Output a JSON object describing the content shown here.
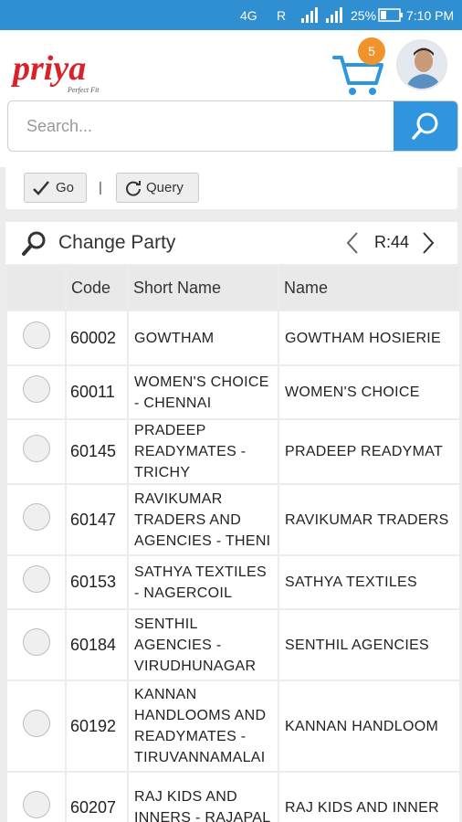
{
  "status_bar": {
    "network": "4G",
    "roaming": "R",
    "battery": "25%",
    "time": "7:10 PM"
  },
  "header": {
    "brand": "priya",
    "tagline": "Perfect Fit",
    "cart_count": "5"
  },
  "search": {
    "placeholder": "Search..."
  },
  "toolbar": {
    "go_label": "Go",
    "separator": "|",
    "query_label": "Query"
  },
  "party_panel": {
    "title": "Change Party",
    "record_count": "R:44"
  },
  "table": {
    "columns": [
      "",
      "Code",
      "Short Name",
      "Name"
    ],
    "rows": [
      {
        "code": "60002",
        "short_name": "GOWTHAM",
        "name": "GOWTHAM HOSIERIE"
      },
      {
        "code": "60011",
        "short_name": "WOMEN'S CHOICE - CHENNAI",
        "name": "WOMEN'S CHOICE"
      },
      {
        "code": "60145",
        "short_name": "PRADEEP READYMATES - TRICHY",
        "name": "PRADEEP READYMAT"
      },
      {
        "code": "60147",
        "short_name": "RAVIKUMAR TRADERS AND AGENCIES - THENI",
        "name": "RAVIKUMAR TRADERS"
      },
      {
        "code": "60153",
        "short_name": "SATHYA TEXTILES - NAGERCOIL",
        "name": "SATHYA TEXTILES"
      },
      {
        "code": "60184",
        "short_name": "SENTHIL AGENCIES - VIRUDHUNAGAR",
        "name": "SENTHIL AGENCIES"
      },
      {
        "code": "60192",
        "short_name": "KANNAN HANDLOOMS AND READYMATES - TIRUVANNAMALAI",
        "name": "KANNAN HANDLOOM"
      },
      {
        "code": "60207",
        "short_name": "RAJ KIDS AND INNERS - RAJAPAL",
        "name": "RAJ KIDS AND INNER"
      }
    ]
  },
  "colors": {
    "status_bar": "#2f8fd0",
    "search_button": "#2f95de",
    "cart": "#2f95de",
    "badge": "#f0932b",
    "logo": "#d8232a"
  }
}
